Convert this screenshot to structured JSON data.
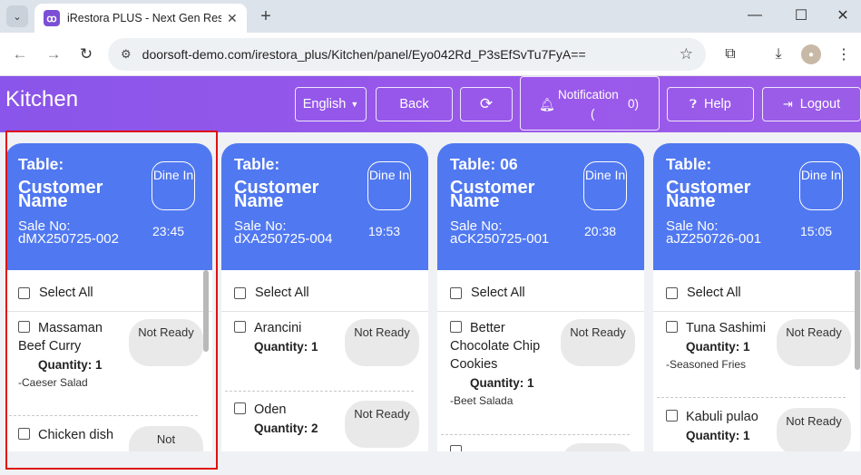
{
  "browser": {
    "tab_title": "iRestora PLUS - Next Gen Resta",
    "url": "doorsoft-demo.com/irestora_plus/Kitchen/panel/Eyo042Rd_P3sEfSvTu7FyA=="
  },
  "header": {
    "brand": "Kitchen",
    "language": "English",
    "back": "Back",
    "notification_label": "Notification",
    "notification_open": "(",
    "notification_count": "0)",
    "help": "Help",
    "logout": "Logout"
  },
  "cards": [
    {
      "table": "Table:",
      "customer": "Customer Name",
      "dine": "Dine In",
      "sale_no": "Sale No: dMX250725-002",
      "time": "23:45",
      "select_all": "Select All",
      "items": [
        {
          "name": "Massaman Beef Curry",
          "quantity": "Quantity: 1",
          "modifier": "-Caeser Salad",
          "status": "Not Ready"
        },
        {
          "name": "Chicken dish",
          "status": "Not"
        }
      ]
    },
    {
      "table": "Table:",
      "customer": "Customer Name",
      "dine": "Dine In",
      "sale_no": "Sale No: dXA250725-004",
      "time": "19:53",
      "select_all": "Select All",
      "items": [
        {
          "name": "Arancini",
          "quantity": "Quantity: 1",
          "status": "Not Ready"
        },
        {
          "name": "Oden",
          "quantity": "Quantity: 2",
          "status": "Not Ready"
        }
      ]
    },
    {
      "table": "Table: 06",
      "customer": "Customer Name",
      "dine": "Dine In",
      "sale_no": "Sale No: aCK250725-001",
      "time": "20:38",
      "select_all": "Select All",
      "items": [
        {
          "name": "Better Chocolate Chip Cookies",
          "quantity": "Quantity: 1",
          "modifier": "-Beet Salada",
          "status": "Not Ready"
        }
      ]
    },
    {
      "table": "Table:",
      "customer": "Customer Name",
      "dine": "Dine In",
      "sale_no": "Sale No: aJZ250726-001",
      "time": "15:05",
      "select_all": "Select All",
      "items": [
        {
          "name": "Tuna Sashimi",
          "quantity": "Quantity: 1",
          "modifier": "-Seasoned Fries",
          "status": "Not Ready"
        },
        {
          "name": "Kabuli pulao",
          "quantity": "Quantity: 1",
          "status": "Not Ready"
        }
      ]
    }
  ],
  "colors": {
    "header_purple": "#9156ea",
    "card_header_blue": "#5078f0",
    "highlight_red": "#e01010"
  }
}
